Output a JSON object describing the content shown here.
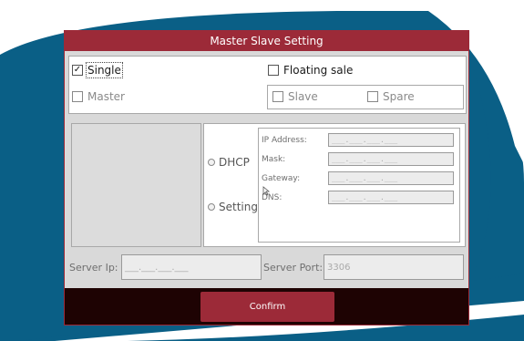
{
  "dialog": {
    "title": "Master Slave Setting"
  },
  "mode": {
    "single": {
      "label": "Single",
      "checked": true
    },
    "floating": {
      "label": "Floating sale",
      "checked": false
    },
    "master": {
      "label": "Master",
      "checked": false
    },
    "slave": {
      "label": "Slave",
      "checked": false
    },
    "spare": {
      "label": "Spare",
      "checked": false
    }
  },
  "network": {
    "dhcp_label": "DHCP",
    "setting_label": "Setting",
    "fields": [
      {
        "label": "IP Address:",
        "value": "___.___.___.___"
      },
      {
        "label": "Mask:",
        "value": "___.___.___.___"
      },
      {
        "label": "Gateway:",
        "value": "___.___.___.___"
      },
      {
        "label": "DNS:",
        "value": "___.___.___.___"
      }
    ]
  },
  "server": {
    "ip_label": "Server Ip:",
    "ip_value": "___.___.___.___",
    "port_label": "Server Port:",
    "port_value": "3306"
  },
  "footer": {
    "confirm_label": "Confirm"
  },
  "colors": {
    "accent": "#9c2a38",
    "wallpaper": "#0a5f86",
    "bar": "#1e0303"
  },
  "icons": {
    "checkmark": "check-icon",
    "pointer": "mouse-pointer-icon"
  }
}
